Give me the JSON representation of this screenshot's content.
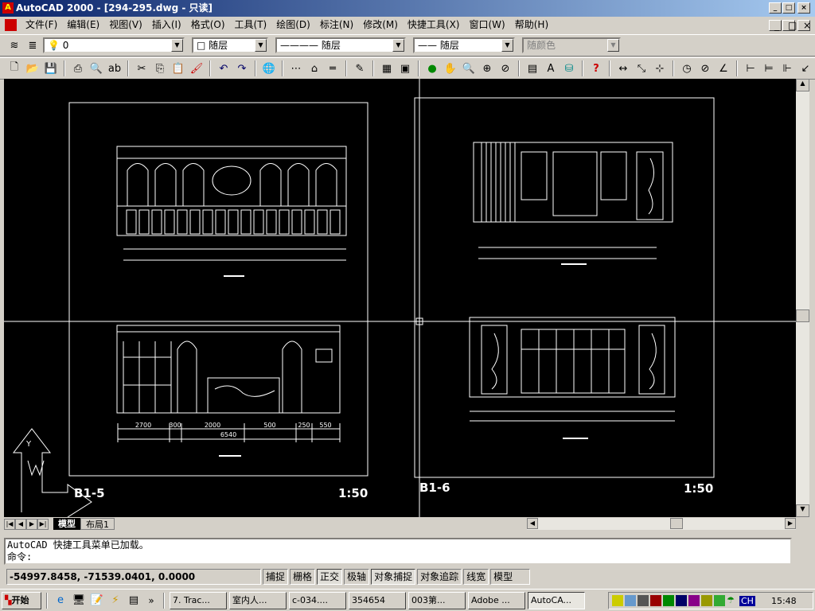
{
  "window": {
    "title": "AutoCAD 2000 - [294-295.dwg - 只读]",
    "min": "_",
    "max": "□",
    "close": "×"
  },
  "menu": [
    "文件(F)",
    "编辑(E)",
    "视图(V)",
    "插入(I)",
    "格式(O)",
    "工具(T)",
    "绘图(D)",
    "标注(N)",
    "修改(M)",
    "快捷工具(X)",
    "窗口(W)",
    "帮助(H)"
  ],
  "properties": {
    "layer": "0",
    "color": "随层",
    "linetype": "———— 随层",
    "lineweight": "—— 随层",
    "plotstyle": "随颜色"
  },
  "drawing": {
    "left_sheet": {
      "id": "B1-5",
      "scale": "1:50",
      "dims_bottom": [
        "2700",
        "300",
        "2000",
        "500",
        "250",
        "550"
      ],
      "dims_total": "6540"
    },
    "right_sheet": {
      "id": "B1-6",
      "scale": "1:50"
    }
  },
  "tabs": {
    "model": "模型",
    "layout1": "布局1"
  },
  "command": {
    "history": "AutoCAD 快捷工具菜单已加载。",
    "prompt": "命令:"
  },
  "status": {
    "coords": "-54997.8458, -71539.0401, 0.0000",
    "toggles": [
      "捕捉",
      "栅格",
      "正交",
      "极轴",
      "对象捕捉",
      "对象追踪",
      "线宽",
      "模型"
    ]
  },
  "taskbar": {
    "start": "开始",
    "more": "»",
    "tasks": [
      "7. Trac...",
      "室内人...",
      "c-034....",
      "354654",
      "003第...",
      "Adobe ...",
      "AutoCA..."
    ],
    "tray_lang": "CH",
    "clock": "15:48"
  }
}
